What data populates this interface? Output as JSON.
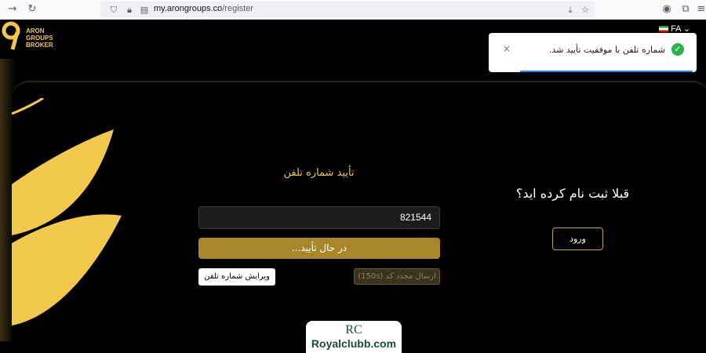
{
  "browser": {
    "url_host": "my.arongroups.co",
    "url_path": "/register",
    "icons": [
      "forward-icon",
      "reload-icon",
      "shield-icon",
      "lock-icon",
      "page-info-icon",
      "download-icon",
      "star-icon",
      "account-icon",
      "extensions-icon",
      "menu-icon"
    ]
  },
  "header": {
    "logo_lines": [
      "ARON",
      "GROUPS",
      "BROKER"
    ],
    "language": "FA"
  },
  "verify": {
    "title": "تأیید شماره تلفن",
    "phone_value": "821544",
    "confirm_label": "در حال تأیید...",
    "resend_label": "ارسال مجدد کد (150s)",
    "edit_label": "ویرایش شماره تلفن"
  },
  "login": {
    "question": "قبلا ثبت نام کرده اید؟",
    "button_label": "ورود"
  },
  "toast": {
    "message": "شماره تلفن با موفقیت تأیید شد.",
    "close": "×"
  },
  "watermark": {
    "mark": "RC",
    "site": "Royalclubb.com"
  },
  "colors": {
    "accent": "#f2c94c",
    "button": "#a8862a",
    "success": "#2bb24c"
  }
}
